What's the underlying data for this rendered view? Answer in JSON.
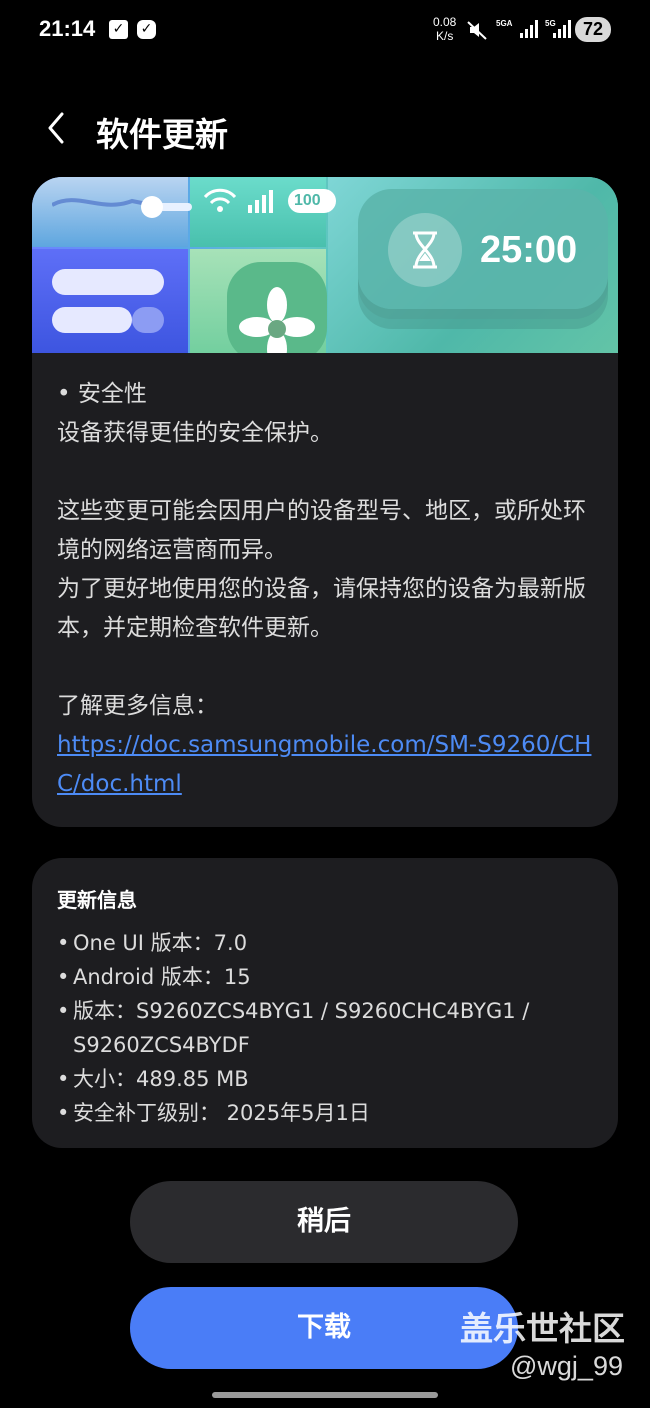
{
  "status_bar": {
    "time": "21:14",
    "net_speed_value": "0.08",
    "net_speed_unit": "K/s",
    "signal_1_label": "5GA",
    "signal_2_label": "5G",
    "battery": "72"
  },
  "header": {
    "title": "软件更新"
  },
  "banner": {
    "timer": "25:00",
    "battery": "100"
  },
  "release_notes": {
    "section_title": "• 安全性",
    "section_body": "设备获得更佳的安全保护。",
    "paragraph_1": "这些变更可能会因用户的设备型号、地区，或所处环境的网络运营商而异。",
    "paragraph_2": "为了更好地使用您的设备，请保持您的设备为最新版本，并定期检查软件更新。",
    "more_info_label": "了解更多信息：",
    "link": "https://doc.samsungmobile.com/SM-S9260/CHC/doc.html"
  },
  "update_info": {
    "title": "更新信息",
    "items": [
      "One UI 版本：7.0",
      "Android 版本：15",
      "版本：S9260ZCS4BYG1 / S9260CHC4BYG1 / S9260ZCS4BYDF",
      "大小：489.85 MB",
      "安全补丁级别： 2025年5月1日"
    ]
  },
  "buttons": {
    "later": "稍后",
    "download": "下载"
  },
  "watermark": {
    "site": "盖乐世社区",
    "user": "@wgj_99"
  },
  "colors": {
    "background": "#000000",
    "card": "#1d1d20",
    "link": "#4d8bf5",
    "download_button": "#4a7df7",
    "later_button": "#2b2b2e"
  }
}
